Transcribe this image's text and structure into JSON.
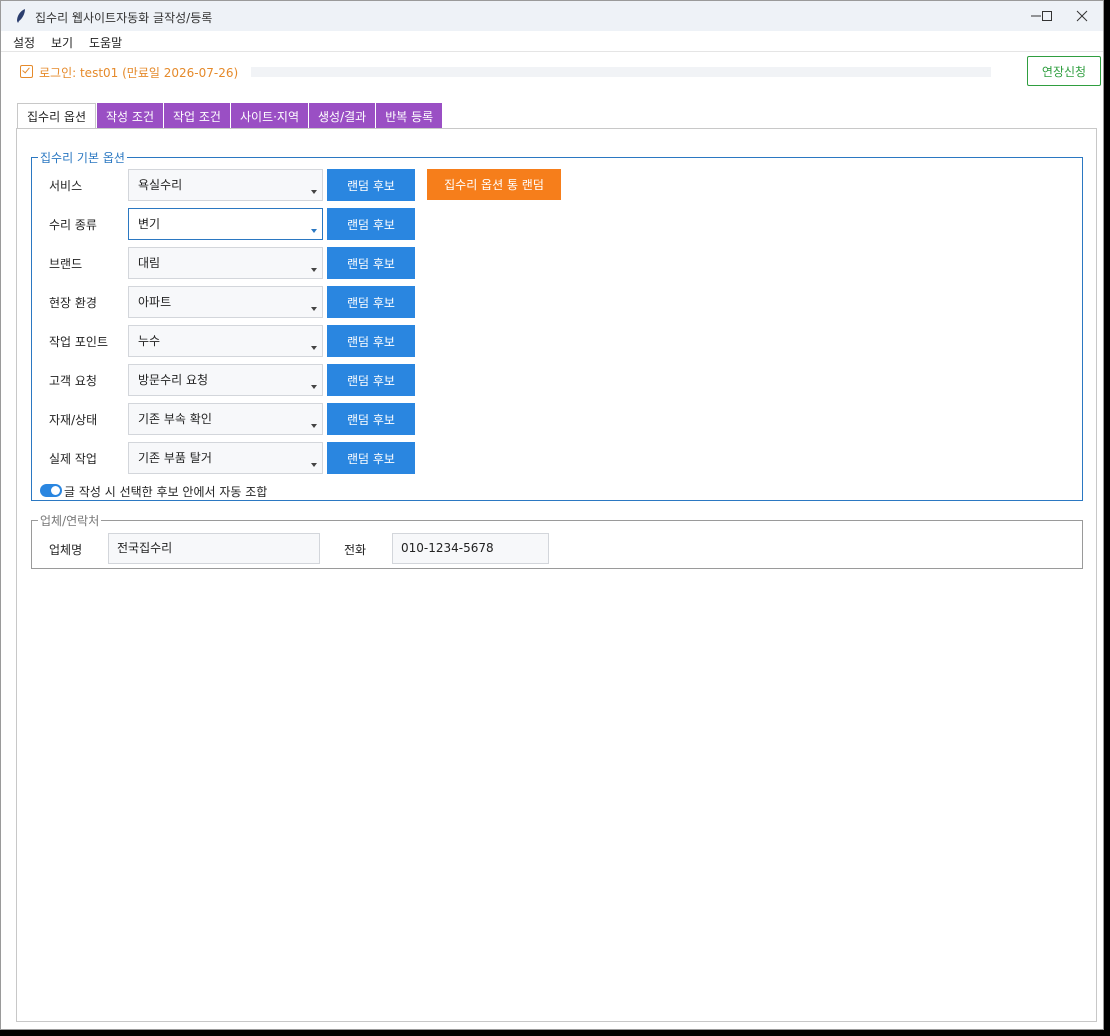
{
  "window": {
    "title": "집수리 웹사이트자동화 글작성/등록",
    "minimize_icon": "minimize-icon",
    "maximize_icon": "maximize-icon",
    "close_icon": "close-icon"
  },
  "menu": [
    "설정",
    "보기",
    "도움말"
  ],
  "status": {
    "login_text": "로그인: test01 (만료일 2026-07-26)",
    "extend_label": "연장신청",
    "accent_color": "#e58a2b",
    "extend_color": "#2f9e3f"
  },
  "tabs": [
    "집수리 옵션",
    "작성 조건",
    "작업 조건",
    "사이트·지역",
    "생성/결과",
    "반복 등록"
  ],
  "basic_options": {
    "legend": "집수리 기본 옵션",
    "all_random_label": "집수리 옵션 통 랜덤",
    "random_label": "랜덤 후보",
    "rows": [
      {
        "label": "서비스",
        "value": "욕실수리"
      },
      {
        "label": "수리 종류",
        "value": "변기"
      },
      {
        "label": "브랜드",
        "value": "대림"
      },
      {
        "label": "현장 환경",
        "value": "아파트"
      },
      {
        "label": "작업 포인트",
        "value": "누수"
      },
      {
        "label": "고객 요청",
        "value": "방문수리 요청"
      },
      {
        "label": "자재/상태",
        "value": "기존 부속 확인"
      },
      {
        "label": "실제 작업",
        "value": "기존 부품 탈거"
      }
    ],
    "toggle_label": "글 작성 시 선택한 후보 안에서 자동 조합",
    "toggle_on": true
  },
  "contact": {
    "legend": "업체/연락처",
    "company_label": "업체명",
    "company_value": "전국집수리",
    "phone_label": "전화",
    "phone_value": "010-1234-5678"
  }
}
